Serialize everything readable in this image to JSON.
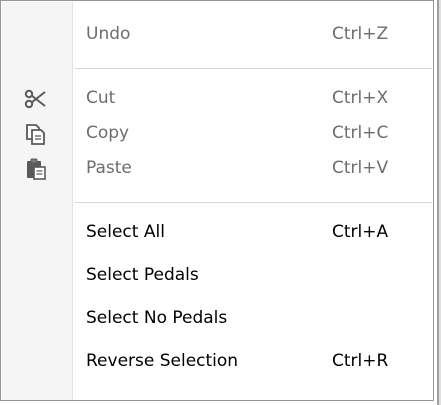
{
  "menu": {
    "items": [
      {
        "label": "Undo",
        "shortcut": "Ctrl+Z",
        "enabled": false,
        "icon": ""
      },
      {
        "label": "Cut",
        "shortcut": "Ctrl+X",
        "enabled": false,
        "icon": "scissors-icon"
      },
      {
        "label": "Copy",
        "shortcut": "Ctrl+C",
        "enabled": false,
        "icon": "copy-icon"
      },
      {
        "label": "Paste",
        "shortcut": "Ctrl+V",
        "enabled": false,
        "icon": "clipboard-paste-icon"
      },
      {
        "label": "Select All",
        "shortcut": "Ctrl+A",
        "enabled": true,
        "icon": ""
      },
      {
        "label": "Select Pedals",
        "shortcut": "",
        "enabled": true,
        "icon": ""
      },
      {
        "label": "Select No Pedals",
        "shortcut": "",
        "enabled": true,
        "icon": ""
      },
      {
        "label": "Reverse Selection",
        "shortcut": "Ctrl+R",
        "enabled": true,
        "icon": ""
      }
    ]
  },
  "colors": {
    "disabled_text": "#6d6d6d",
    "enabled_text": "#000000",
    "gutter": "#f5f5f5",
    "border": "#979797",
    "icon": "#5a5a5a"
  }
}
